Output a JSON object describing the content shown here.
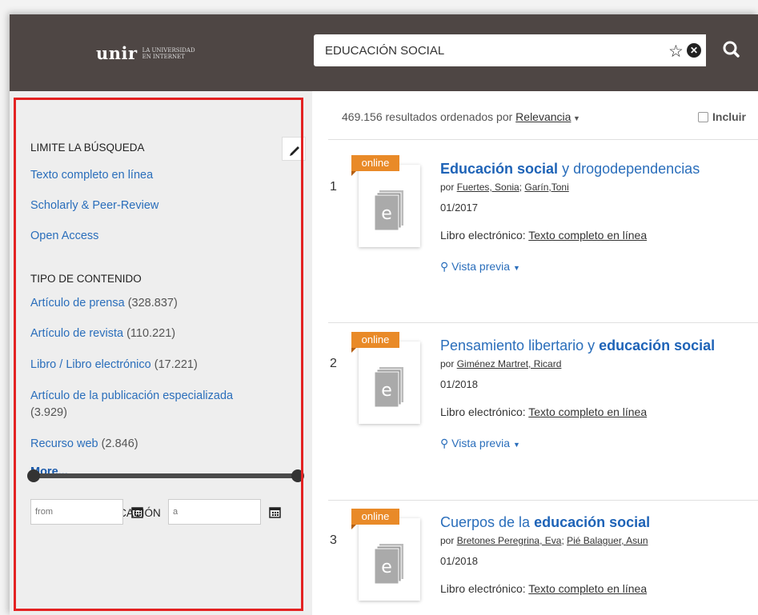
{
  "header": {
    "logo_word": "unir",
    "logo_sub_1": "LA UNIVERSIDAD",
    "logo_sub_2": "EN INTERNET",
    "search_value": "EDUCACIÓN SOCIAL"
  },
  "sidebar": {
    "limit_heading": "LIMITE LA BÚSQUEDA",
    "limit_links": [
      "Texto completo en línea",
      "Scholarly & Peer-Review",
      "Open Access"
    ],
    "content_heading": "TIPO DE CONTENIDO",
    "content_types": [
      {
        "label": "Artículo de prensa",
        "count": "(328.837)"
      },
      {
        "label": "Artículo de revista",
        "count": "(110.221)"
      },
      {
        "label": "Libro / Libro electrónico",
        "count": "(17.221)"
      },
      {
        "label": "Artículo de la publicación especializada",
        "count": "(3.929)"
      },
      {
        "label": "Recurso web",
        "count": "(2.846)"
      }
    ],
    "more_label": "More...",
    "date_heading": "FECHA DE PUBLICACIÓN",
    "from_placeholder": "from",
    "to_placeholder": "a"
  },
  "results": {
    "summary_prefix": "469.156 resultados ordenados por",
    "sort_label": "Relevancia",
    "include_label": "Incluir",
    "items": [
      {
        "num": "1",
        "badge": "online",
        "title_bold": "Educación social",
        "title_rest": " y drogodependencias",
        "by_prefix": "por",
        "authors": [
          "Fuertes, Sonia",
          "Garín,Toni"
        ],
        "date": "01/2017",
        "type_prefix": "Libro electrónico:",
        "type_link": "Texto completo en línea",
        "preview": "Vista previa"
      },
      {
        "num": "2",
        "badge": "online",
        "title_pre": "Pensamiento libertario y ",
        "title_bold": "educación social",
        "by_prefix": "por",
        "authors": [
          "Giménez Martret, Ricard"
        ],
        "date": "01/2018",
        "type_prefix": "Libro electrónico:",
        "type_link": "Texto completo en línea",
        "preview": "Vista previa"
      },
      {
        "num": "3",
        "badge": "online",
        "title_pre": "Cuerpos de la ",
        "title_bold": "educación social",
        "by_prefix": "por",
        "authors": [
          "Bretones Peregrina, Eva",
          "Pié Balaguer, Asun"
        ],
        "date": "01/2018",
        "type_prefix": "Libro electrónico:",
        "type_link": "Texto completo en línea"
      }
    ]
  },
  "colors": {
    "header_bg": "#4e4644",
    "link_blue": "#2a6ebb",
    "badge_orange": "#e98a28",
    "highlight_red": "#e32222"
  }
}
